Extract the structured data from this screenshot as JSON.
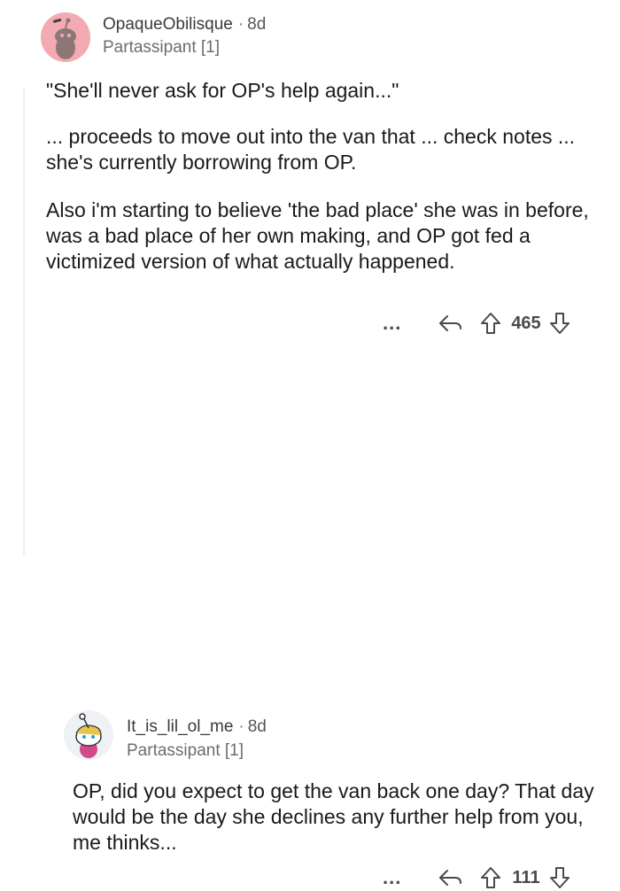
{
  "comments": [
    {
      "username": "OpaqueObilisque",
      "separator": "·",
      "age": "8d",
      "flair": "Partassipant [1]",
      "paragraphs": [
        "\"She'll never ask for OP's help again...\"",
        "... proceeds to move out into the van that ... check notes ... she's currently borrowing from OP.",
        "Also i'm starting to believe 'the bad place' she was in before, was a bad place of her own making, and OP got fed a victimized version of what actually happened."
      ],
      "actions": {
        "more": "...",
        "score": "465"
      }
    },
    {
      "username": "It_is_lil_ol_me",
      "separator": "·",
      "age": "8d",
      "flair": "Partassipant [1]",
      "paragraphs": [
        "OP, did you expect to get the van back one day? That day would be the day she declines any further help from you, me thinks..."
      ],
      "actions": {
        "more": "...",
        "score": "111"
      }
    }
  ],
  "icons": {
    "more": "more-options-icon",
    "reply": "reply-arrow-icon",
    "upvote": "upvote-arrow-icon",
    "downvote": "downvote-arrow-icon",
    "avatar1": "snoo-avatar-icon",
    "avatar2": "snoo-avatar-icon"
  },
  "colors": {
    "text": "#1a1a1b",
    "muted": "#6d6d70",
    "avatar1_bg": "#f4aab3",
    "thread_line": "#edeff1"
  }
}
